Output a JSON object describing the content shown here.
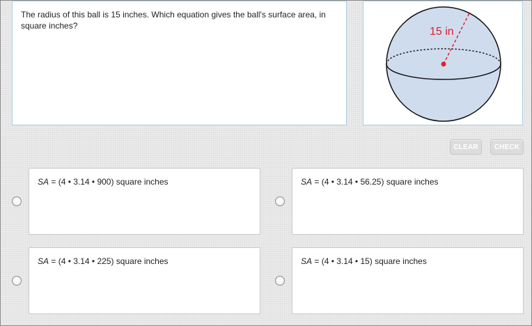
{
  "question": {
    "text": "The radius of this ball is 15 inches. Which equation gives the ball's surface area, in square inches?"
  },
  "figure": {
    "radius_label": "15 in",
    "sphere_fill": "#cfdcee",
    "radius_color": "#e0202a"
  },
  "toolbar": {
    "clear_label": "CLEAR",
    "check_label": "CHECK"
  },
  "choices": [
    {
      "var": "SA",
      "expr": " = (4 • 3.14 • 900) square inches"
    },
    {
      "var": "SA",
      "expr": " = (4 • 3.14 • 56.25) square inches"
    },
    {
      "var": "SA",
      "expr": " = (4 • 3.14 • 225) square inches"
    },
    {
      "var": "SA",
      "expr": " = (4 • 3.14 • 15) square inches"
    }
  ]
}
